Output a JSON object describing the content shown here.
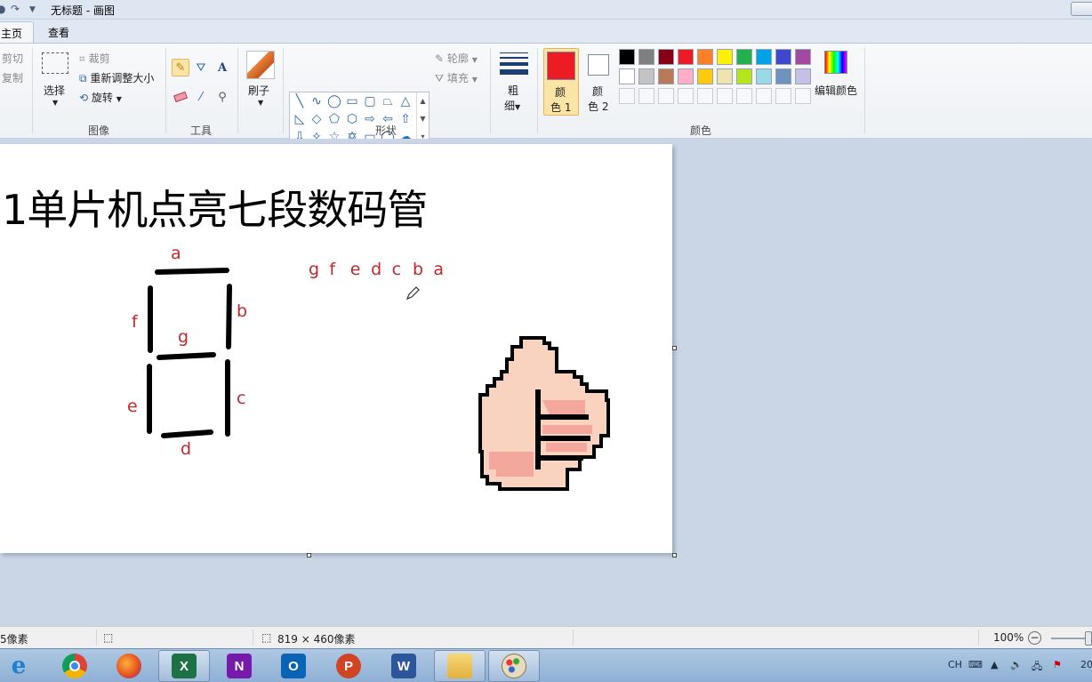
{
  "titlebar": {
    "title": "无标题 - 画图"
  },
  "tabs": [
    {
      "label": "主页"
    },
    {
      "label": "查看"
    }
  ],
  "clipboard": {
    "cut": "剪切",
    "copy": "复制"
  },
  "image_group": {
    "select": "选择",
    "crop": "裁剪",
    "resize": "重新调整大小",
    "rotate": "旋转",
    "label": "图像"
  },
  "tools_group": {
    "label": "工具"
  },
  "brush": {
    "label": "刷子"
  },
  "shapes_group": {
    "outline": "轮廓",
    "fill": "填充",
    "label": "形状"
  },
  "size_tool": {
    "line1": "粗",
    "line2": "细"
  },
  "colors_group": {
    "color1_a": "颜",
    "color1_b": "色 1",
    "color2_a": "颜",
    "color2_b": "色 2",
    "edit": "编辑颜色",
    "label": "颜色",
    "primary": "#ed1c24",
    "secondary": "#ffffff",
    "palette_row1": [
      "#000000",
      "#7f7f7f",
      "#880015",
      "#ed1c24",
      "#ff7f27",
      "#fff200",
      "#22b14c",
      "#00a2e8",
      "#3f48cc",
      "#a349a4"
    ],
    "palette_row2": [
      "#ffffff",
      "#c3c3c3",
      "#b97a57",
      "#ffaec9",
      "#ffc90e",
      "#efe4b0",
      "#b5e61d",
      "#99d9ea",
      "#7092be",
      "#c8bfe7"
    ]
  },
  "canvas": {
    "heading": "1单片机点亮七段数码管",
    "seg_a": "a",
    "seg_b": "b",
    "seg_c": "c",
    "seg_d": "d",
    "seg_e": "e",
    "seg_f": "f",
    "seg_g": "g",
    "bit_order": [
      "g",
      "f",
      "e",
      "d",
      "c",
      "b",
      "a"
    ]
  },
  "status": {
    "cursor": "5像素",
    "size": "819 × 460像素",
    "zoom": "100%"
  },
  "taskbar": {
    "lang": "CH",
    "clock": "20"
  }
}
